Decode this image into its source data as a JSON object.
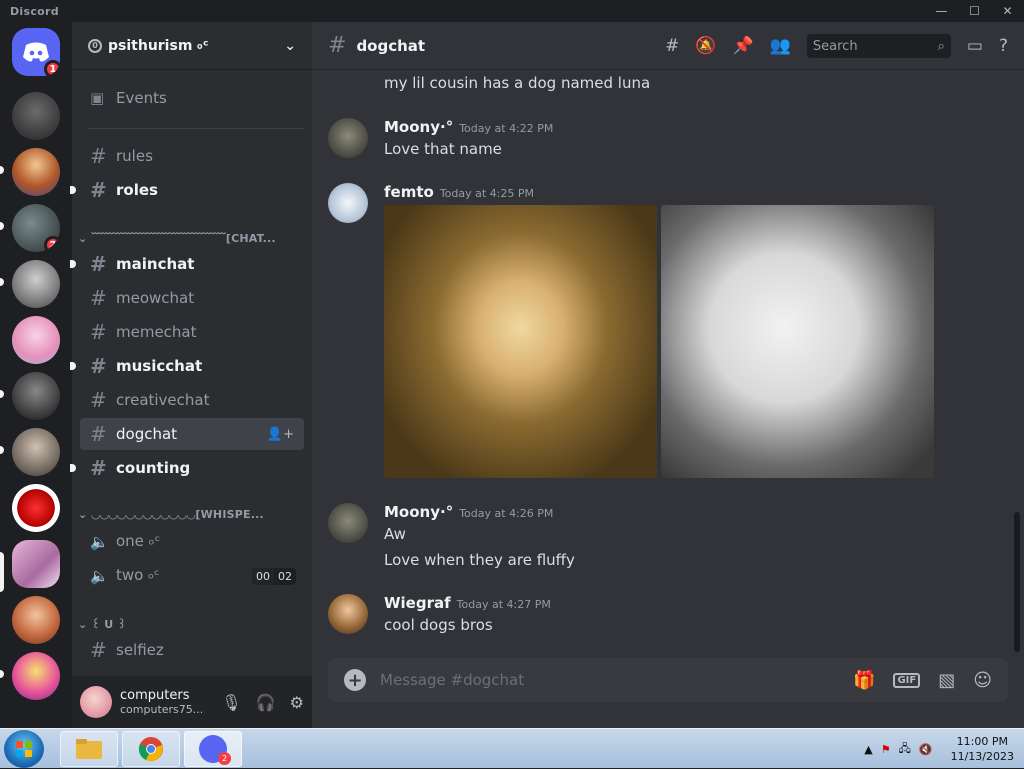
{
  "app": {
    "name": "Discord"
  },
  "servers": [
    {
      "name": "home",
      "badge": "1"
    },
    {
      "name": "server-2",
      "badge": ""
    },
    {
      "name": "server-3",
      "badge": ""
    },
    {
      "name": "server-4",
      "badge": "2"
    },
    {
      "name": "server-5",
      "badge": ""
    },
    {
      "name": "server-6",
      "badge": ""
    },
    {
      "name": "server-7",
      "badge": ""
    },
    {
      "name": "server-8",
      "badge": ""
    },
    {
      "name": "server-9",
      "badge": ""
    },
    {
      "name": "server-10",
      "badge": ""
    },
    {
      "name": "server-11",
      "badge": ""
    },
    {
      "name": "server-12",
      "badge": ""
    }
  ],
  "server": {
    "name": "psithurism ৹ᶜ"
  },
  "sidebar": {
    "events": "Events",
    "categories": {
      "chat": "﹋﹋﹋﹋﹋﹋﹋﹋﹋﹋﹋﹋[CHAT...",
      "whisper": "◡◡◡◡◡◡◡◡◡◡◡◡[WHISPE...",
      "eu": "꒰ U ꒱"
    },
    "channels": {
      "rules": "rules",
      "roles": "roles",
      "mainchat": "mainchat",
      "meowchat": "meowchat",
      "memechat": "memechat",
      "musicchat": "musicchat",
      "creativechat": "creativechat",
      "dogchat": "dogchat",
      "counting": "counting",
      "one": "one ৹ᶜ",
      "two": "two ৹ᶜ",
      "selfiez": "selfiez"
    },
    "voice_counts": {
      "left": "00",
      "right": "02"
    }
  },
  "user": {
    "name": "computers",
    "tag": "computers75..."
  },
  "channel": {
    "name": "dogchat",
    "search_placeholder": "Search"
  },
  "messages": {
    "prev_line": "my lil cousin has a dog named luna",
    "m1": {
      "author": "Moony·°",
      "time": "Today at 4:22 PM",
      "text": "Love that name"
    },
    "m2": {
      "author": "femto",
      "time": "Today at 4:25 PM"
    },
    "m3": {
      "author": "Moony·°",
      "time": "Today at 4:26 PM",
      "text1": "Aw",
      "text2": "Love when they are fluffy"
    },
    "m4": {
      "author": "Wiegraf",
      "time": "Today at 4:27 PM",
      "text": "cool dogs bros"
    }
  },
  "composer": {
    "placeholder": "Message #dogchat",
    "gif": "GIF"
  },
  "taskbar": {
    "time": "11:00 PM",
    "date": "11/13/2023",
    "discord_badge": "2"
  }
}
